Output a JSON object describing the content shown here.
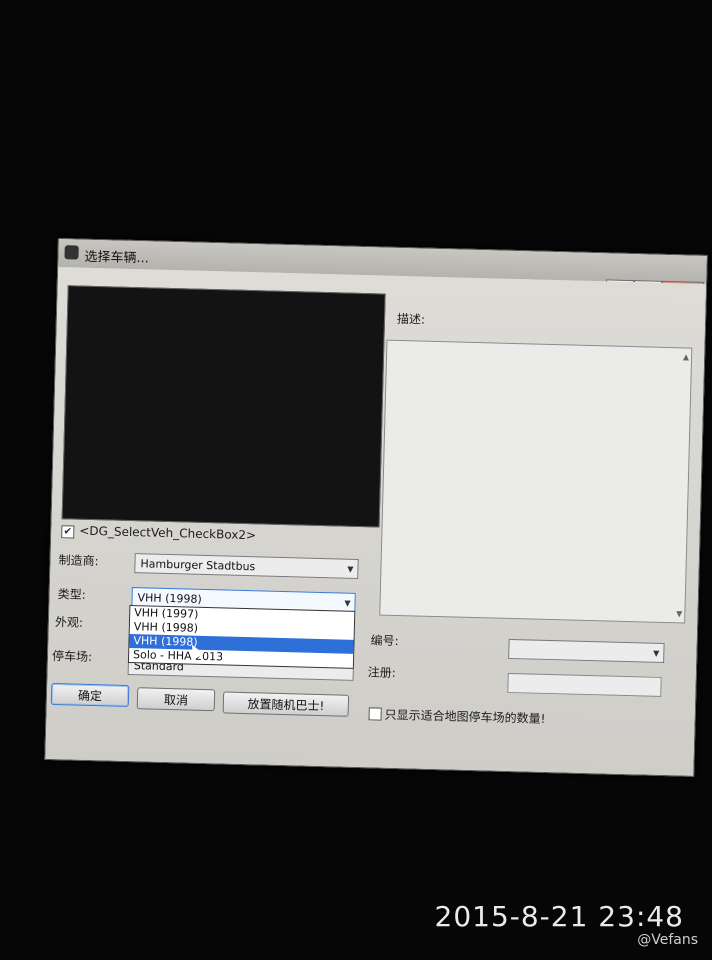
{
  "window": {
    "title": "选择车辆...",
    "minimize_label": "▁",
    "maximize_label": "□",
    "close_label": "✕"
  },
  "preview": {
    "checkbox_checked": true,
    "checkbox_label": "<DG_SelectVeh_CheckBox2>"
  },
  "form": {
    "manufacturer_label": "制造商:",
    "manufacturer_value": "Hamburger Stadtbus",
    "type_label": "类型:",
    "type_value": "VHH (1998)",
    "appearance_label": "外观:",
    "depot_label": "停车场:",
    "depot_value": "Standard"
  },
  "type_dropdown": {
    "options": [
      "VHH (1997)",
      "VHH (1998)",
      "VHH (1998)",
      "Solo - HHA 2013"
    ],
    "selected_index": 2
  },
  "description": {
    "label": "描述:",
    "text": ""
  },
  "number": {
    "label": "编号:",
    "value": ""
  },
  "registration": {
    "label": "注册:",
    "value": ""
  },
  "buttons": {
    "ok": "确定",
    "cancel": "取消",
    "random": "放置随机巴士!"
  },
  "filter": {
    "checked": false,
    "label": "只显示适合地图停车场的数量!"
  },
  "photo": {
    "timestamp": "2015-8-21 23:48",
    "watermark": "@Vefans"
  }
}
